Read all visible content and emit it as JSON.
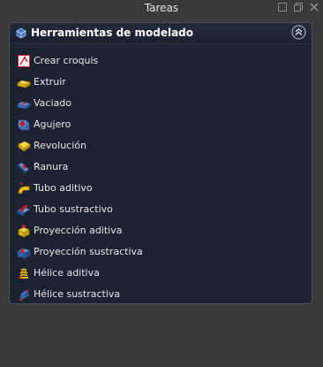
{
  "window": {
    "title": "Tareas"
  },
  "panel": {
    "title": "Herramientas de modelado",
    "items": [
      {
        "label": "Crear croquis",
        "icon": "sketch-icon"
      },
      {
        "label": "Extruir",
        "icon": "pad-icon"
      },
      {
        "label": "Vaciado",
        "icon": "pocket-icon"
      },
      {
        "label": "Agujero",
        "icon": "hole-icon"
      },
      {
        "label": "Revolución",
        "icon": "revolution-icon"
      },
      {
        "label": "Ranura",
        "icon": "groove-icon"
      },
      {
        "label": "Tubo aditivo",
        "icon": "additive-pipe-icon"
      },
      {
        "label": "Tubo sustractivo",
        "icon": "subtractive-pipe-icon"
      },
      {
        "label": "Proyección aditiva",
        "icon": "additive-loft-icon"
      },
      {
        "label": "Proyección sustractiva",
        "icon": "subtractive-loft-icon"
      },
      {
        "label": "Hélice aditiva",
        "icon": "additive-helix-icon"
      },
      {
        "label": "Hélice sustractiva",
        "icon": "subtractive-helix-icon"
      }
    ]
  },
  "colors": {
    "panel_bg": "#1c2230",
    "window_bg": "#3a3a3a",
    "text": "#e8e8e8",
    "additive": "#f2c21b",
    "subtractive": "#c8202a",
    "blue": "#2f5fa8"
  }
}
